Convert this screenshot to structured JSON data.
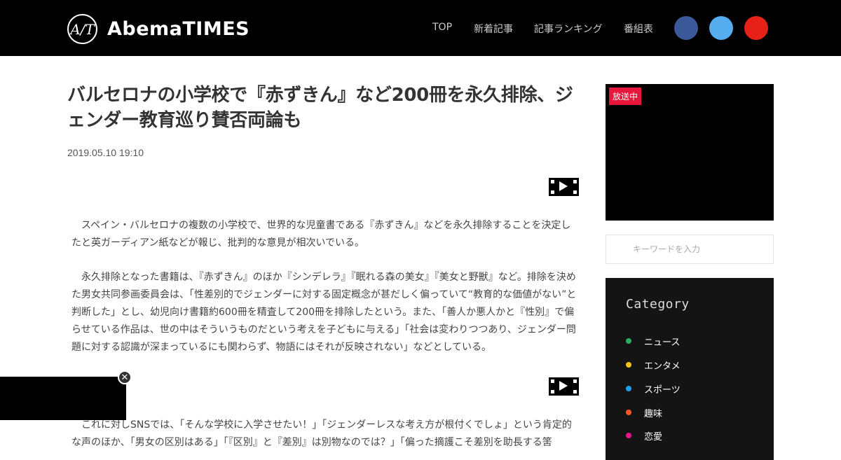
{
  "header": {
    "logo_mark": "A/T",
    "logo_text": "AbemaTIMES",
    "nav": [
      {
        "label": "TOP"
      },
      {
        "label": "新着記事"
      },
      {
        "label": "記事ランキング"
      },
      {
        "label": "番組表"
      }
    ],
    "social": [
      {
        "icon": "facebook-icon",
        "glyph": "",
        "color": "#3b5998"
      },
      {
        "icon": "twitter-icon",
        "glyph": "",
        "color": "#55acee"
      },
      {
        "icon": "youtube-icon",
        "glyph": "",
        "color": "#e62117"
      }
    ]
  },
  "article": {
    "title": "バルセロナの小学校で『赤ずきん』など200冊を永久排除、ジェンダー教育巡り賛否両論も",
    "date": "2019.05.10 19:10",
    "paragraphs": [
      "スペイン・バルセロナの複数の小学校で、世界的な児童書である『赤ずきん』などを永久排除することを決定したと英ガーディアン紙などが報じ、批判的な意見が相次いでいる。",
      "永久排除となった書籍は、『赤ずきん』のほか『シンデレラ』『眠れる森の美女』『美女と野獣』など。排除を決めた男女共同参画委員会は、「性差別的でジェンダーに対する固定概念が甚だしく偏っていて“教育的な価値がない”と判断した」とし、幼児向け書籍約600冊を精査して200冊を排除したという。また、「善人か悪人かと『性別』で偏らせている作品は、世の中はそういうものだという考えを子どもに与える」「社会は変わりつつあり、ジェンダー問題に対する認識が深まっているにも関わらず、物語にはそれが反映されない」などとしている。",
      "これに対しSNSでは、「そんな学校に入学させたい！」「ジェンダーレスな考え方が根付くでしょ」という肯定的な声のほか、「男女の区別はある」「『区別』と『差別』は別物なのでは？」「偏った摘護こそ差別を助長する筈"
    ],
    "video_icon": "video-play-icon"
  },
  "float_player": {
    "close_glyph": "✕"
  },
  "sidebar": {
    "live_badge": "放送中",
    "search": {
      "icon_glyph": "",
      "placeholder": "キーワードを入力"
    },
    "category": {
      "title": "Category",
      "items": [
        {
          "label": "ニュース",
          "color": "#27ae60"
        },
        {
          "label": "エンタメ",
          "color": "#f1c40f"
        },
        {
          "label": "スポーツ",
          "color": "#1ea0f0"
        },
        {
          "label": "趣味",
          "color": "#ff5a1e"
        },
        {
          "label": "恋愛",
          "color": "#e9158c"
        }
      ]
    }
  }
}
